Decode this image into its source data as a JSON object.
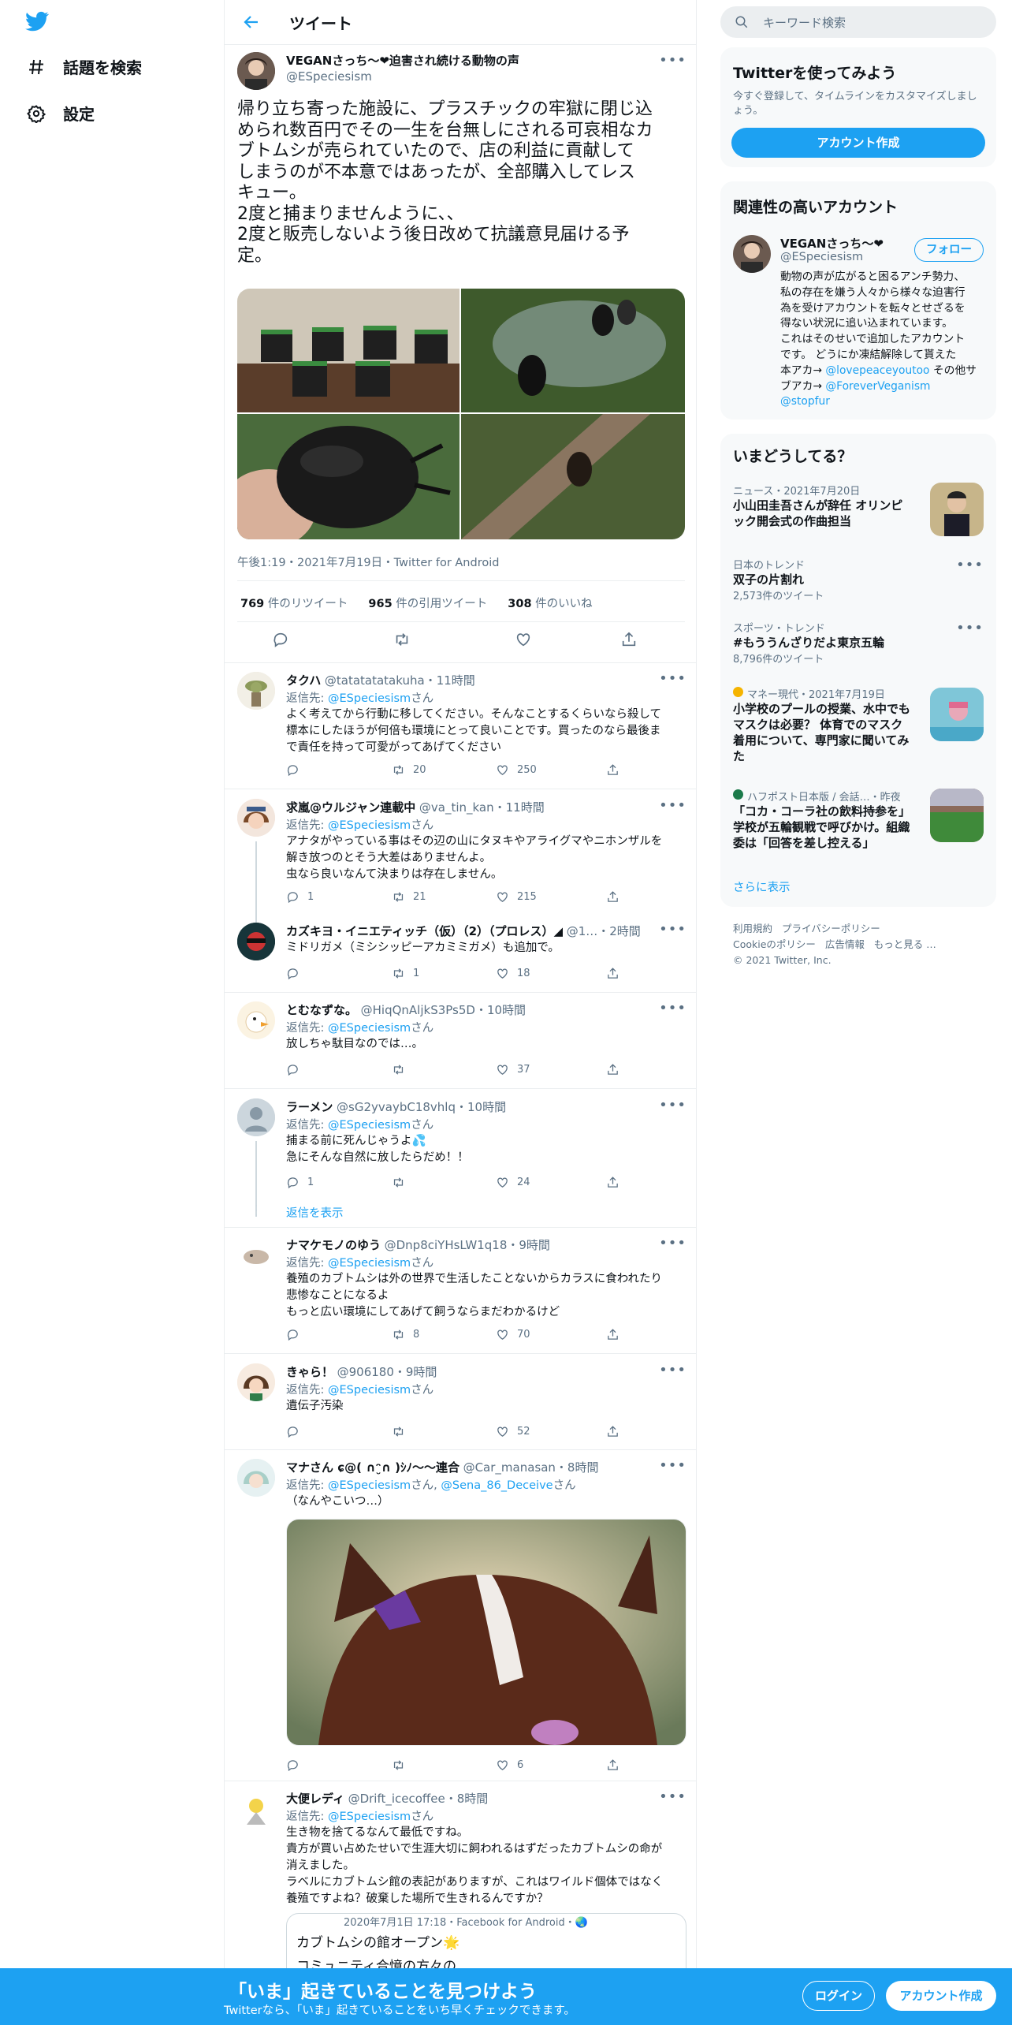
{
  "nav": {
    "explore": "話題を検索",
    "settings": "設定"
  },
  "header": {
    "title": "ツイート"
  },
  "main_tweet": {
    "name": "VEGANさっち～❤迫害され続ける動物の声",
    "handle": "@ESpeciesism",
    "text_lines": [
      "帰り立ち寄った施設に、プラスチックの牢獄に閉じ込",
      "められ数百円でその一生を台無しにされる可哀相なカ",
      "ブトムシが売られていたので、店の利益に貢献して",
      "しまうのが不本意ではあったが、全部購入してレス",
      "キュー。",
      "2度と捕まりませんように、、",
      "2度と販売しないよう後日改めて抗議意見届ける予",
      "定。"
    ],
    "timestamp": "午後1:19・2021年7月19日・Twitter for Android",
    "retweets": "769",
    "retweets_label": "件のリツイート",
    "quotes": "965",
    "quotes_label": "件の引用ツイート",
    "likes": "308",
    "likes_label": "件のいいね"
  },
  "replies": [
    {
      "name": "タクハ",
      "handle": "@tatatatatakuha",
      "time": "・11時間",
      "replyto_label": "返信先: ",
      "replyto": "@ESpeciesism",
      "san": "さん",
      "lines": [
        "よく考えてから行動に移してください。そんなことするくらいなら殺して",
        "標本にしたほうが何倍も環境にとって良いことです。買ったのなら最後ま",
        "で責任を持って可愛がってあげてください"
      ],
      "rt": "20",
      "like": "250",
      "reply": ""
    },
    {
      "name": "求嵐@ウルジャン連載中",
      "handle": "@va_tin_kan",
      "time": "・11時間",
      "replyto_label": "返信先: ",
      "replyto": "@ESpeciesism",
      "san": "さん",
      "lines": [
        "アナタがやっている事はその辺の山にタヌキやアライグマやニホンザルを",
        "解き放つのとそう大差はありませんよ。",
        "虫なら良いなんて決まりは存在しません。"
      ],
      "rt": "21",
      "like": "215",
      "reply": "1"
    },
    {
      "name": "カズキヨ・イニエティッチ（仮）（2）（プロレス）◢",
      "handle": "@1…",
      "time": "・2時間",
      "replyto_label": "",
      "replyto": "",
      "san": "",
      "lines": [
        "ミドリガメ（ミシシッピーアカミミガメ）も追加で。"
      ],
      "rt": "1",
      "like": "18",
      "reply": ""
    },
    {
      "name": "とむなずな。",
      "handle": "@HiqQnAljkS3Ps5D",
      "time": "・10時間",
      "replyto_label": "返信先: ",
      "replyto": "@ESpeciesism",
      "san": "さん",
      "lines": [
        "放しちゃ駄目なのでは…。"
      ],
      "rt": "",
      "like": "37",
      "reply": ""
    },
    {
      "name": "ラーメン",
      "handle": "@sG2yvaybC18vhlq",
      "time": "・10時間",
      "replyto_label": "返信先: ",
      "replyto": "@ESpeciesism",
      "san": "さん",
      "lines": [
        "捕まる前に死んじゃうよ💦",
        "急にそんな自然に放したらだめ！！"
      ],
      "rt": "",
      "like": "24",
      "reply": "1"
    },
    {
      "name": "ナマケモノのゆう",
      "handle": "@Dnp8ciYHsLW1q18",
      "time": "・9時間",
      "replyto_label": "返信先: ",
      "replyto": "@ESpeciesism",
      "san": "さん",
      "lines": [
        "養殖のカブトムシは外の世界で生活したことないからカラスに食われたり",
        "悲惨なことになるよ",
        "もっと広い環境にしてあげて飼うならまだわかるけど"
      ],
      "rt": "8",
      "like": "70",
      "reply": ""
    },
    {
      "name": "きゃら！",
      "handle": "@906180",
      "time": "・9時間",
      "replyto_label": "返信先: ",
      "replyto": "@ESpeciesism",
      "san": "さん",
      "lines": [
        "遺伝子汚染"
      ],
      "rt": "",
      "like": "52",
      "reply": ""
    },
    {
      "name": "マナさん ɕ@( ∩ᵔ̮∩ )ｼﾉ〜〜連合",
      "handle": "@Car_manasan",
      "time": "・8時間",
      "replyto_label": "返信先: ",
      "replyto": "@ESpeciesism",
      "san": "さん, ",
      "replyto2": "@Sena_86_Deceive",
      "san2": "さん",
      "lines": [
        "（なんやこいつ…）"
      ],
      "rt": "",
      "like": "6",
      "reply": ""
    },
    {
      "name": "大便レディ",
      "handle": "@Drift_icecoffee",
      "time": "・8時間",
      "replyto_label": "返信先: ",
      "replyto": "@ESpeciesism",
      "san": "さん",
      "lines": [
        "生き物を捨てるなんて最低ですね。",
        "貴方が買い占めたせいで生涯大切に飼われるはずだったカブトムシの命が",
        "消えました。",
        "ラベルにカブトムシ館の表記がありますが、これはワイルド個体ではなく",
        "養殖ですよね？破棄した場所で生きれるんですか？"
      ],
      "rt": "",
      "like": "",
      "reply": ""
    }
  ],
  "show_replies": "返信を表示",
  "quoted": {
    "meta": "2020年7月1日 17:18・Facebook for Android・🌏",
    "line1": "カブトムシの館オープン🌟",
    "line2": "コミュニティ合憶の方々の"
  },
  "right": {
    "search_placeholder": "キーワード検索",
    "signup": {
      "title": "Twitterを使ってみよう",
      "desc": "今すぐ登録して、タイムラインをカスタマイズしましょう。",
      "button": "アカウント作成"
    },
    "relevant": {
      "title": "関連性の高いアカウント",
      "name": "VEGANさっち～❤",
      "handle": "@ESpeciesism",
      "follow": "フォロー",
      "bio_lines": [
        "動物の声が広がると困るアンチ勢力、",
        "私の存在を嫌う人々から様々な迫害行",
        "為を受けアカウントを転々とせざるを",
        "得ない状況に追い込まれています。",
        "これはそのせいで追加したアカウント",
        "です。 どうにか凍結解除して貰えた"
      ],
      "bio_main_prefix": "本アカ→ ",
      "bio_main_link": "@lovepeaceyoutoo",
      "bio_main_suffix": " その他サ",
      "bio_sub_prefix": "ブアカ→ ",
      "bio_sub_link": "@ForeverVeganism",
      "bio_last_link": "@stopfur"
    },
    "trends": {
      "title": "いまどうしてる？",
      "items": [
        {
          "meta": "ニュース・2021年7月20日",
          "title": "小山田圭吾さんが辞任 オリンピック開会式の作曲担当",
          "count": ""
        },
        {
          "meta": "日本のトレンド",
          "title": "双子の片割れ",
          "count": "2,573件のツイート"
        },
        {
          "meta": "スポーツ・トレンド",
          "title": "#もううんざりだよ東京五輪",
          "count": "8,796件のツイート"
        },
        {
          "meta": "マネー現代・2021年7月19日",
          "title": "小学校のプールの授業、水中でもマスクは必要？ 体育でのマスク着用について、専門家に聞いてみた",
          "count": ""
        },
        {
          "meta": "ハフポスト日本版 / 会話…・昨夜",
          "title": "「コカ・コーラ社の飲料持参を」学校が五輪観戦で呼びかけ。組織委は「回答を差し控える」",
          "count": ""
        }
      ],
      "more": "さらに表示"
    },
    "footer": {
      "terms": "利用規約",
      "privacy": "プライバシーポリシー",
      "cookie": "Cookieのポリシー",
      "ads": "広告情報",
      "more": "もっと見る …",
      "copyright": "© 2021 Twitter, Inc."
    }
  },
  "bottom": {
    "headline": "「いま」起きていることを見つけよう",
    "sub": "Twitterなら、「いま」起きていることをいち早くチェックできます。",
    "login": "ログイン",
    "signup": "アカウント作成"
  },
  "colors": {
    "accent": "#1da1f2",
    "text": "#0f1419",
    "secondary": "#5b7083",
    "heart": "#e0245e"
  }
}
